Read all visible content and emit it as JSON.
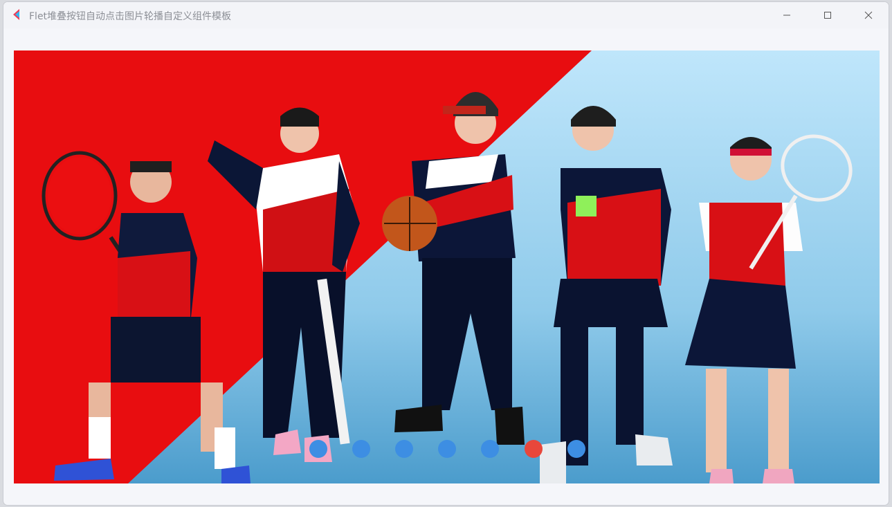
{
  "window": {
    "title": "Flet堆叠按钮自动点击图片轮播自定义组件模板",
    "controls": [
      "minimize-icon",
      "maximize-icon",
      "close-icon"
    ]
  },
  "carousel": {
    "image_description_icon": "kids-sportswear-banner-image",
    "dot_count": 7,
    "active_index": 5,
    "dot_color": "#3d8ee3",
    "active_dot_color": "#e8473b"
  }
}
